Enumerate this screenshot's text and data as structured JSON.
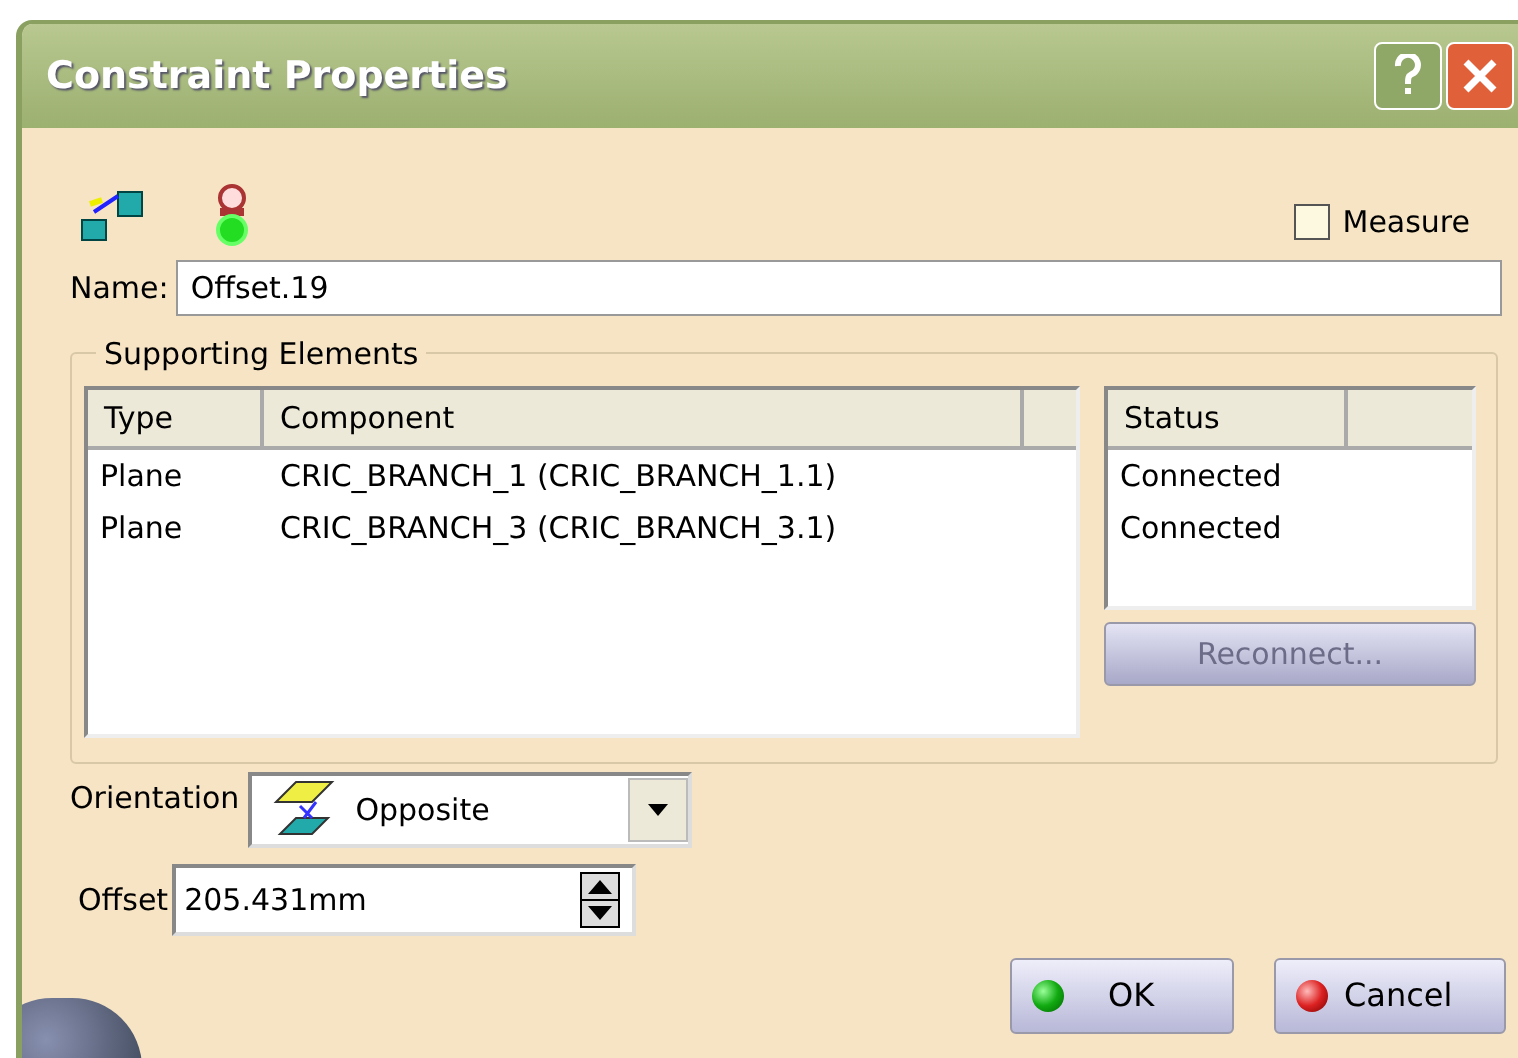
{
  "window": {
    "title": "Constraint Properties"
  },
  "measure": {
    "label": "Measure",
    "checked": false
  },
  "name": {
    "label": "Name:",
    "value": "Offset.19"
  },
  "supporting_elements": {
    "title": "Supporting Elements",
    "columns": [
      "Type",
      "Component"
    ],
    "rows": [
      {
        "type": "Plane",
        "component": "CRIC_BRANCH_1 (CRIC_BRANCH_1.1)"
      },
      {
        "type": "Plane",
        "component": "CRIC_BRANCH_3 (CRIC_BRANCH_3.1)"
      }
    ],
    "status_column": "Status",
    "statuses": [
      "Connected",
      "Connected"
    ],
    "reconnect": {
      "label": "Reconnect...",
      "disabled": true
    }
  },
  "orientation": {
    "label": "Orientation",
    "value": "Opposite"
  },
  "offset": {
    "label": "Offset",
    "value": "205.431mm"
  },
  "buttons": [
    {
      "label": "OK",
      "kind": "ok"
    },
    {
      "label": "Cancel",
      "kind": "cancel"
    }
  ]
}
